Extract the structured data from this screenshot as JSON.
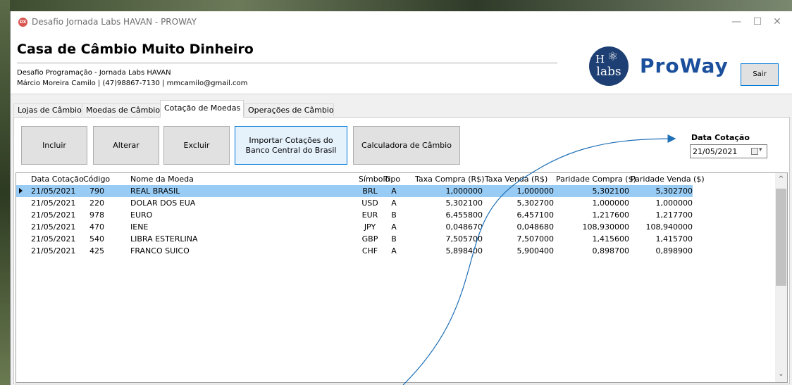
{
  "window": {
    "title": "Desafio Jornada Labs HAVAN - PROWAY",
    "icon_text": "DX",
    "controls": {
      "minimize": "—",
      "maximize": "☐",
      "close": "✕"
    }
  },
  "header": {
    "company_title": "Casa de Câmbio Muito Dinheiro",
    "subtitle": "Desafio Programação - Jornada Labs HAVAN",
    "contact": "Márcio Moreira Camilo | (47)98867-7130 | mmcamilo@gmail.com",
    "logo_h": "H",
    "logo_labs": "labs",
    "logo_atom": "⚛",
    "brand_name": "ProWay",
    "exit_button": "Sair",
    "brand_color": "#1b4f9c"
  },
  "tabs": [
    {
      "label": "Lojas de Câmbio",
      "active": false
    },
    {
      "label": "Moedas de Câmbio",
      "active": false
    },
    {
      "label": "Cotação de Moedas",
      "active": true
    },
    {
      "label": "Operações de Câmbio",
      "active": false
    }
  ],
  "toolbar": {
    "include": "Incluir",
    "edit": "Alterar",
    "delete": "Excluir",
    "import": "Importar Cotações do Banco Central do Brasil",
    "calculator": "Calculadora de Câmbio"
  },
  "date_filter": {
    "label": "Data Cotação",
    "value": "21/05/2021",
    "caret": "▾"
  },
  "grid": {
    "columns": [
      "Data Cotação",
      "Código",
      "Nome da Moeda",
      "Símbolo",
      "Tipo",
      "Taxa Compra (R$)",
      "Taxa Venda (R$)",
      "Paridade Compra ($)",
      "Paridade Venda ($)"
    ],
    "rows": [
      [
        "21/05/2021",
        "790",
        "REAL BRASIL",
        "BRL",
        "A",
        "1,000000",
        "1,000000",
        "5,302100",
        "5,302700"
      ],
      [
        "21/05/2021",
        "220",
        "DOLAR DOS EUA",
        "USD",
        "A",
        "5,302100",
        "5,302700",
        "1,000000",
        "1,000000"
      ],
      [
        "21/05/2021",
        "978",
        "EURO",
        "EUR",
        "B",
        "6,455800",
        "6,457100",
        "1,217600",
        "1,217700"
      ],
      [
        "21/05/2021",
        "470",
        "IENE",
        "JPY",
        "A",
        "0,048670",
        "0,048680",
        "108,930000",
        "108,940000"
      ],
      [
        "21/05/2021",
        "540",
        "LIBRA ESTERLINA",
        "GBP",
        "B",
        "7,505700",
        "7,507000",
        "1,415600",
        "1,415700"
      ],
      [
        "21/05/2021",
        "425",
        "FRANCO SUICO",
        "CHF",
        "A",
        "5,898400",
        "5,900400",
        "0,898700",
        "0,898900"
      ]
    ],
    "selected_row": 0,
    "selected_color": "#99ccf5",
    "scroll_up": "^",
    "scroll_down": "⌄"
  },
  "annotation": {
    "color": "#1e6fb5"
  }
}
